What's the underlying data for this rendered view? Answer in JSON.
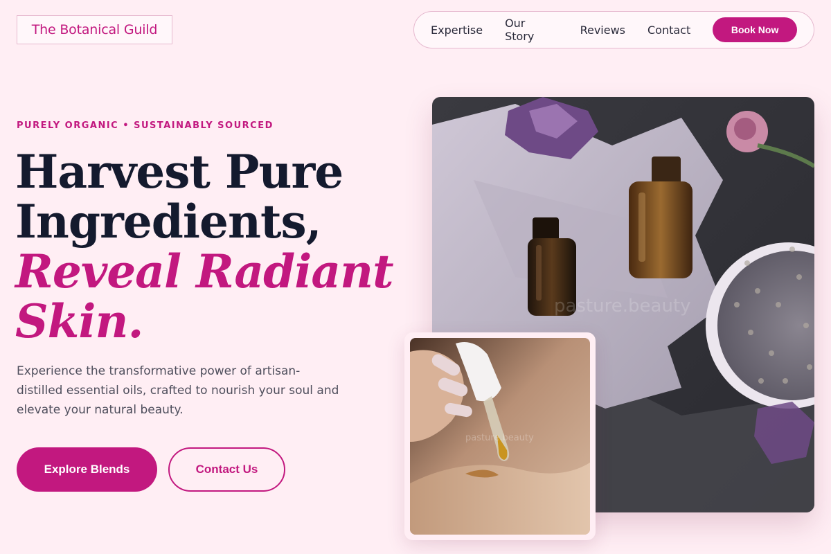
{
  "brand": {
    "name": "The Botanical Guild"
  },
  "nav": {
    "links": [
      "Expertise",
      "Our Story",
      "Reviews",
      "Contact"
    ],
    "cta": "Book Now"
  },
  "hero": {
    "eyebrow": "PURELY ORGANIC • SUSTAINABLY SOURCED",
    "headline_lines": [
      "Harvest Pure",
      "Ingredients,"
    ],
    "headline_accent_lines": [
      "Reveal Radiant",
      "Skin."
    ],
    "lead": "Experience the transformative power of artisan-distilled essential oils, crafted to nourish your soul and elevate your natural beauty.",
    "primary_cta": "Explore Blends",
    "secondary_cta": "Contact Us"
  },
  "images": {
    "main_watermark": "pasture.beauty",
    "inset_watermark": "pasture.beauty"
  },
  "colors": {
    "page_bg": "#ffeef4",
    "accent": "#c2187f",
    "headline": "#141a2e"
  }
}
